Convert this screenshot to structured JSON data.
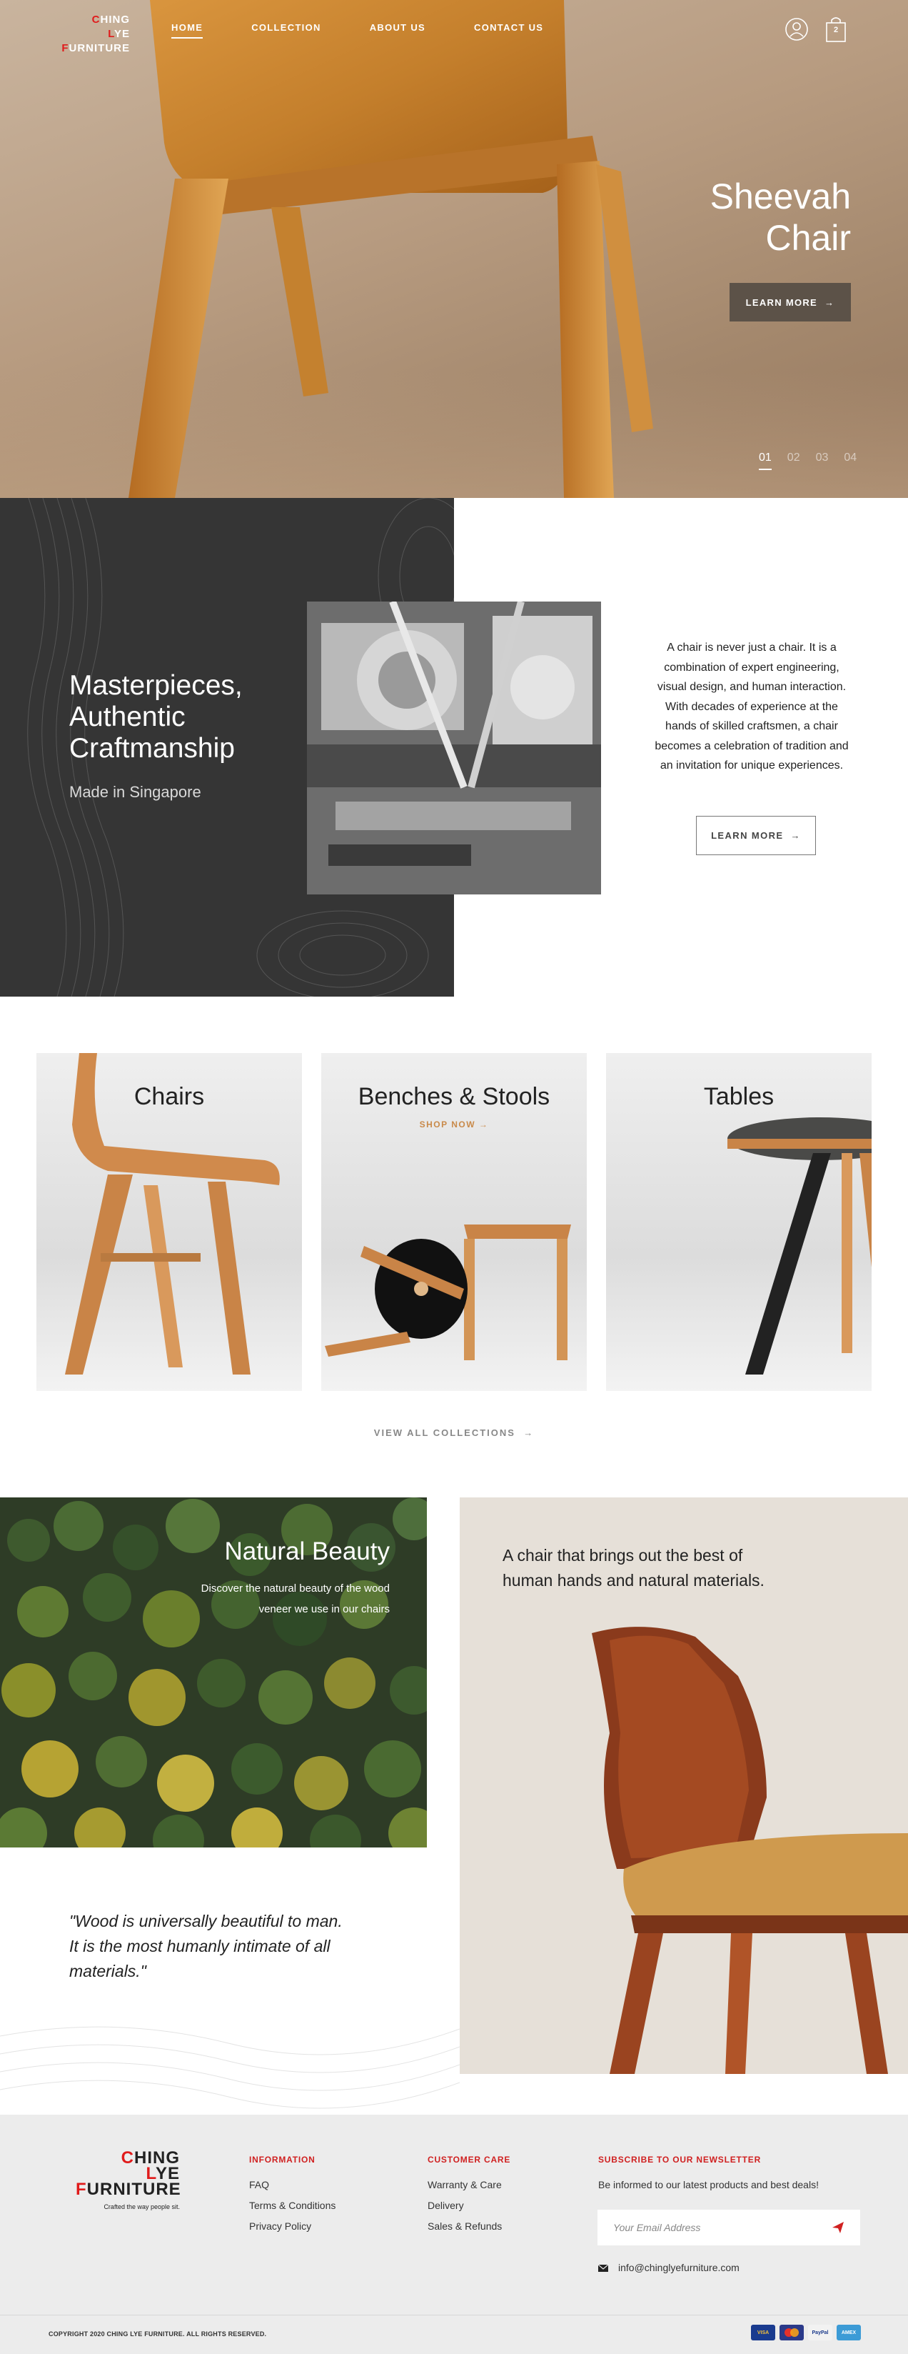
{
  "brand": {
    "line1": "CHING",
    "line2": "LYE",
    "line3": "FURNITURE",
    "tagline": "Crafted the way people sit."
  },
  "nav": {
    "items": [
      "HOME",
      "COLLECTION",
      "ABOUT US",
      "CONTACT US"
    ],
    "active": "HOME"
  },
  "header": {
    "cart_count": "2",
    "icons": [
      "user-icon",
      "shopping-bag-icon"
    ]
  },
  "hero": {
    "title_line1": "Sheevah",
    "title_line2": "Chair",
    "cta": "LEARN MORE",
    "slides": [
      "01",
      "02",
      "03",
      "04"
    ],
    "current_slide": "01"
  },
  "craft": {
    "title_line1": "Masterpieces,",
    "title_line2": "Authentic",
    "title_line3": "Craftmanship",
    "subtitle": "Made in Singapore",
    "body": "A chair is never just a chair. It is a combination of expert engineering, visual design, and human interaction. With decades of experience at the hands of skilled craftsmen, a chair becomes a celebration of tradition and an invitation for unique experiences.",
    "cta": "LEARN MORE"
  },
  "collections": {
    "cards": [
      {
        "title": "Chairs"
      },
      {
        "title": "Benches & Stools",
        "cta": "SHOP NOW"
      },
      {
        "title": "Tables"
      }
    ],
    "view_all": "VIEW ALL COLLECTIONS"
  },
  "nature": {
    "title": "Natural Beauty",
    "subtitle_line1": "Discover the natural beauty of the wood",
    "subtitle_line2": "veneer we use in our chairs",
    "chair_text_line1": "A chair that brings out the best of",
    "chair_text_line2": "human hands and natural materials.",
    "quote_line1": "\"Wood is universally beautiful to man.",
    "quote_line2": "It is the most humanly intimate of all",
    "quote_line3": "materials.\""
  },
  "footer": {
    "information": {
      "heading": "INFORMATION",
      "links": [
        "FAQ",
        "Terms & Conditions",
        "Privacy Policy"
      ]
    },
    "customer_care": {
      "heading": "CUSTOMER CARE",
      "links": [
        "Warranty & Care",
        "Delivery",
        "Sales & Refunds"
      ]
    },
    "newsletter": {
      "heading": "SUBSCRIBE TO OUR NEWSLETTER",
      "text": "Be informed to our latest products and best deals!",
      "placeholder": "Your Email Address",
      "email": "info@chinglyefurniture.com"
    },
    "copyright": "COPYRIGHT 2020 CHING LYE FURNITURE. ALL RIGHTS RESERVED.",
    "payments": [
      "VISA",
      "MC",
      "PayPal",
      "AMEX"
    ]
  },
  "colors": {
    "accent": "#d02020",
    "dark": "#353535",
    "shop_now": "#c98a4a"
  }
}
